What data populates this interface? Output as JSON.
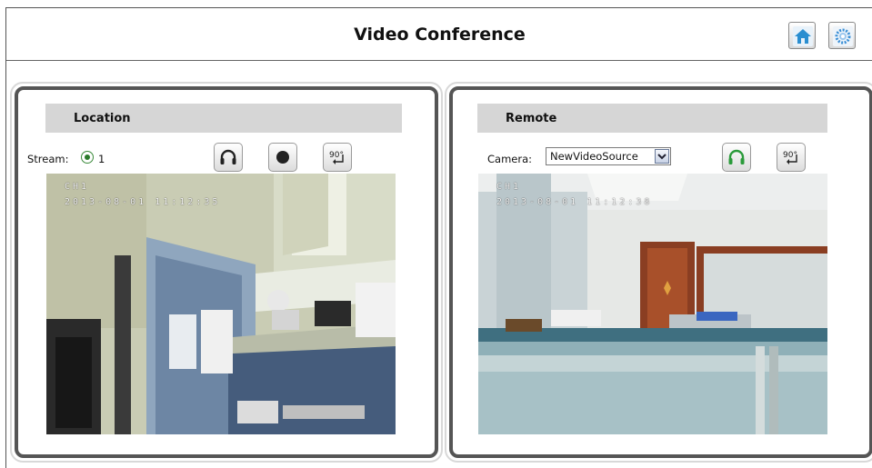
{
  "header": {
    "title": "Video Conference",
    "home_icon": "home-icon",
    "settings_icon": "gear-icon"
  },
  "location": {
    "title": "Location",
    "stream_label": "Stream:",
    "stream_option": "1",
    "audio_icon": "headphones-icon",
    "record_icon": "record-icon",
    "rotate_label": "90°",
    "osd_line1": "CH1",
    "osd_line2": "2013-08-01 11:12:35"
  },
  "remote": {
    "title": "Remote",
    "camera_label": "Camera:",
    "camera_value": "NewVideoSource",
    "audio_icon": "headphones-icon",
    "rotate_label": "90°",
    "osd_line1": "CH1",
    "osd_line2": "2013-08-01 11:12:38"
  },
  "colors": {
    "panel_border": "#555555",
    "panel_header_bg": "#d6d6d6",
    "accent_green": "#2a9a3a",
    "home_blue": "#2a8ed0"
  }
}
